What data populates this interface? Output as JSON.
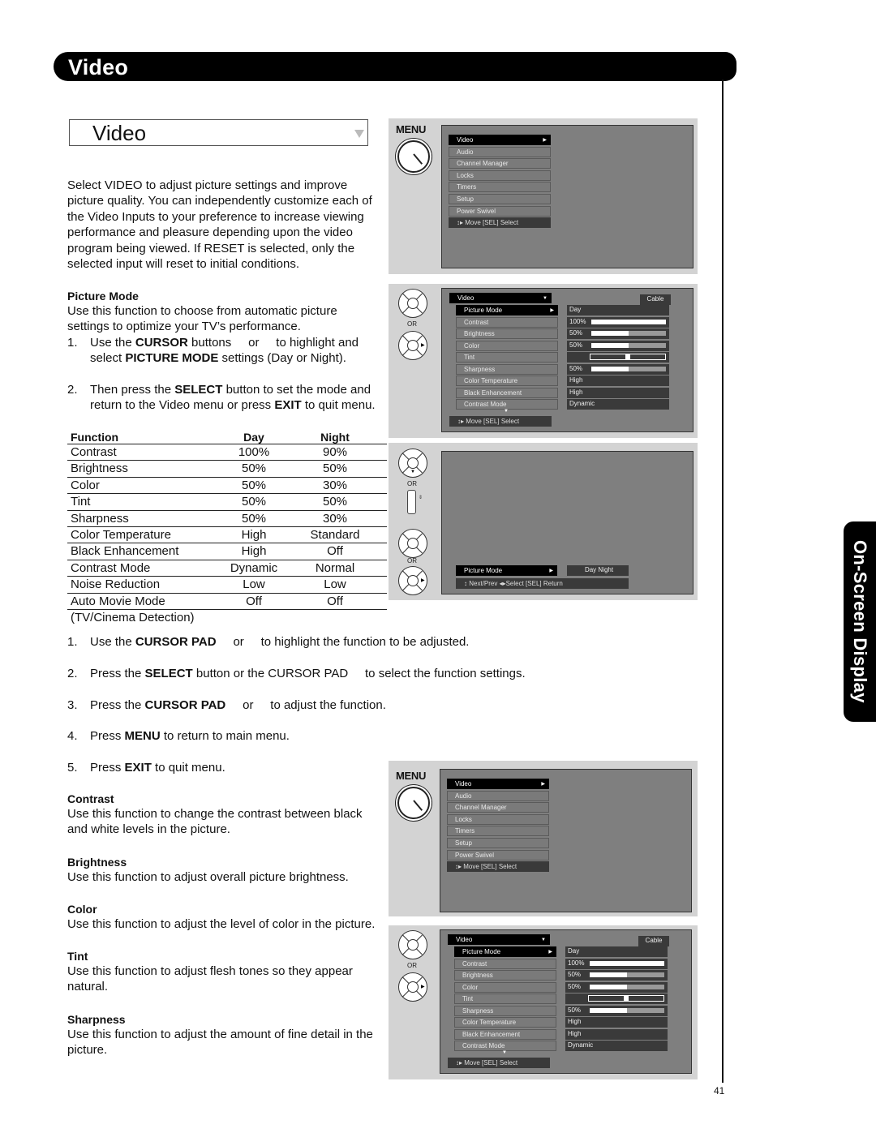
{
  "header": {
    "title": "Video"
  },
  "side_tab": {
    "label": "On-Screen Display"
  },
  "page_number": "41",
  "dropdown": {
    "label": "Video",
    "icon": "triangle-down-icon"
  },
  "intro": "Select VIDEO to adjust picture settings and improve picture quality. You can independently customize each of the Video Inputs to your preference to increase viewing performance and pleasure depending upon the video program being viewed. If RESET is selected, only the selected input will reset to initial conditions.",
  "intro_lines": [
    "Select VIDEO to adjust picture settings and improve",
    "picture quality. You can independently customize each of",
    "the Video Inputs to your preference to increase viewing",
    "performance and pleasure depending upon the video",
    "program being viewed. If RESET is selected, only the",
    "selected input will reset to initial conditions."
  ],
  "picture_mode": {
    "heading": "Picture Mode",
    "desc_lines": [
      "Use this function to choose from automatic picture",
      "settings to optimize your TV’s performance."
    ],
    "steps": [
      {
        "num": "1.",
        "lines": [
          "Use the <b>CURSOR</b> buttons &nbsp;&nbsp;&nbsp;&nbsp;or &nbsp;&nbsp;&nbsp;&nbsp;to highlight and",
          "select <b>PICTURE MODE</b> settings (Day or Night)."
        ]
      },
      {
        "num": "2.",
        "lines": [
          "Then press the <b>SELECT</b> button to set the mode and",
          "return to the Video menu or press <b>EXIT</b> to quit menu."
        ]
      }
    ]
  },
  "table": {
    "headers": [
      "Function",
      "Day",
      "Night"
    ],
    "rows": [
      [
        "Contrast",
        "100%",
        "90%"
      ],
      [
        "Brightness",
        "50%",
        "50%"
      ],
      [
        "Color",
        "50%",
        "30%"
      ],
      [
        "Tint",
        "50%",
        "50%"
      ],
      [
        "Sharpness",
        "50%",
        "30%"
      ],
      [
        "Color Temperature",
        "High",
        "Standard"
      ],
      [
        "Black Enhancement",
        "High",
        "Off"
      ],
      [
        "Contrast Mode",
        "Dynamic",
        "Normal"
      ],
      [
        "Noise Reduction",
        "Low",
        "Low"
      ],
      [
        "Auto Movie Mode",
        "Off",
        "Off"
      ]
    ],
    "footnote": "(TV/Cinema Detection)"
  },
  "steps": [
    {
      "num": "1.",
      "html": "Use the <b>CURSOR PAD</b> &nbsp;&nbsp;&nbsp;&nbsp;or &nbsp;&nbsp;&nbsp;&nbsp;to highlight the function to be adjusted."
    },
    {
      "num": "2.",
      "html": "Press the <b>SELECT</b> button or the CURSOR PAD &nbsp;&nbsp;&nbsp;&nbsp;to select the function settings."
    },
    {
      "num": "3.",
      "html": "Press the <b>CURSOR PAD</b> &nbsp;&nbsp;&nbsp;&nbsp;or &nbsp;&nbsp;&nbsp;&nbsp;to adjust the function."
    },
    {
      "num": "4.",
      "html": "Press <b>MENU</b> to return to main menu."
    },
    {
      "num": "5.",
      "html": "Press <b>EXIT</b> to quit menu."
    }
  ],
  "sections": [
    {
      "heading": "Contrast",
      "lines": [
        "Use this function to change the contrast between black",
        "and white levels in the picture."
      ]
    },
    {
      "heading": "Brightness",
      "lines": [
        "Use this function to adjust overall picture brightness."
      ]
    },
    {
      "heading": "Color",
      "lines": [
        "Use this function to adjust the level of color in the picture."
      ]
    },
    {
      "heading": "Tint",
      "lines": [
        "Use this function to adjust flesh tones so they appear",
        "natural."
      ]
    },
    {
      "heading": "Sharpness",
      "lines": [
        "Use this function to adjust the amount of fine detail in the",
        "picture."
      ]
    }
  ],
  "osd": {
    "menu_button_label": "MENU",
    "or_label": "OR",
    "main_menu": {
      "items": [
        "Video",
        "Audio",
        "Channel Manager",
        "Locks",
        "Timers",
        "Setup",
        "Power Swivel"
      ],
      "selected_index": 0,
      "footer": "↕▸ Move    [SEL] Select"
    },
    "video_menu": {
      "title": "Video",
      "source": "Cable",
      "items": [
        {
          "label": "Picture Mode",
          "value": "Day",
          "type": "text"
        },
        {
          "label": "Contrast",
          "value": "100%",
          "type": "bar",
          "level": 1.0
        },
        {
          "label": "Brightness",
          "value": "50%",
          "type": "bar",
          "level": 0.5
        },
        {
          "label": "Color",
          "value": "50%",
          "type": "bar",
          "level": 0.5
        },
        {
          "label": "Tint",
          "value": "",
          "type": "tint",
          "level": 0.5
        },
        {
          "label": "Sharpness",
          "value": "50%",
          "type": "bar",
          "level": 0.5
        },
        {
          "label": "Color Temperature",
          "value": "High",
          "type": "text"
        },
        {
          "label": "Black Enhancement",
          "value": "High",
          "type": "text"
        },
        {
          "label": "Contrast Mode",
          "value": "Dynamic",
          "type": "text"
        }
      ],
      "footer": "↕▸ Move    [SEL] Select"
    },
    "picture_mode_popup": {
      "label": "Picture Mode",
      "options": "Day    Night",
      "footer": "↕ Next/Prev  ◂▸Select   [SEL] Return"
    }
  }
}
